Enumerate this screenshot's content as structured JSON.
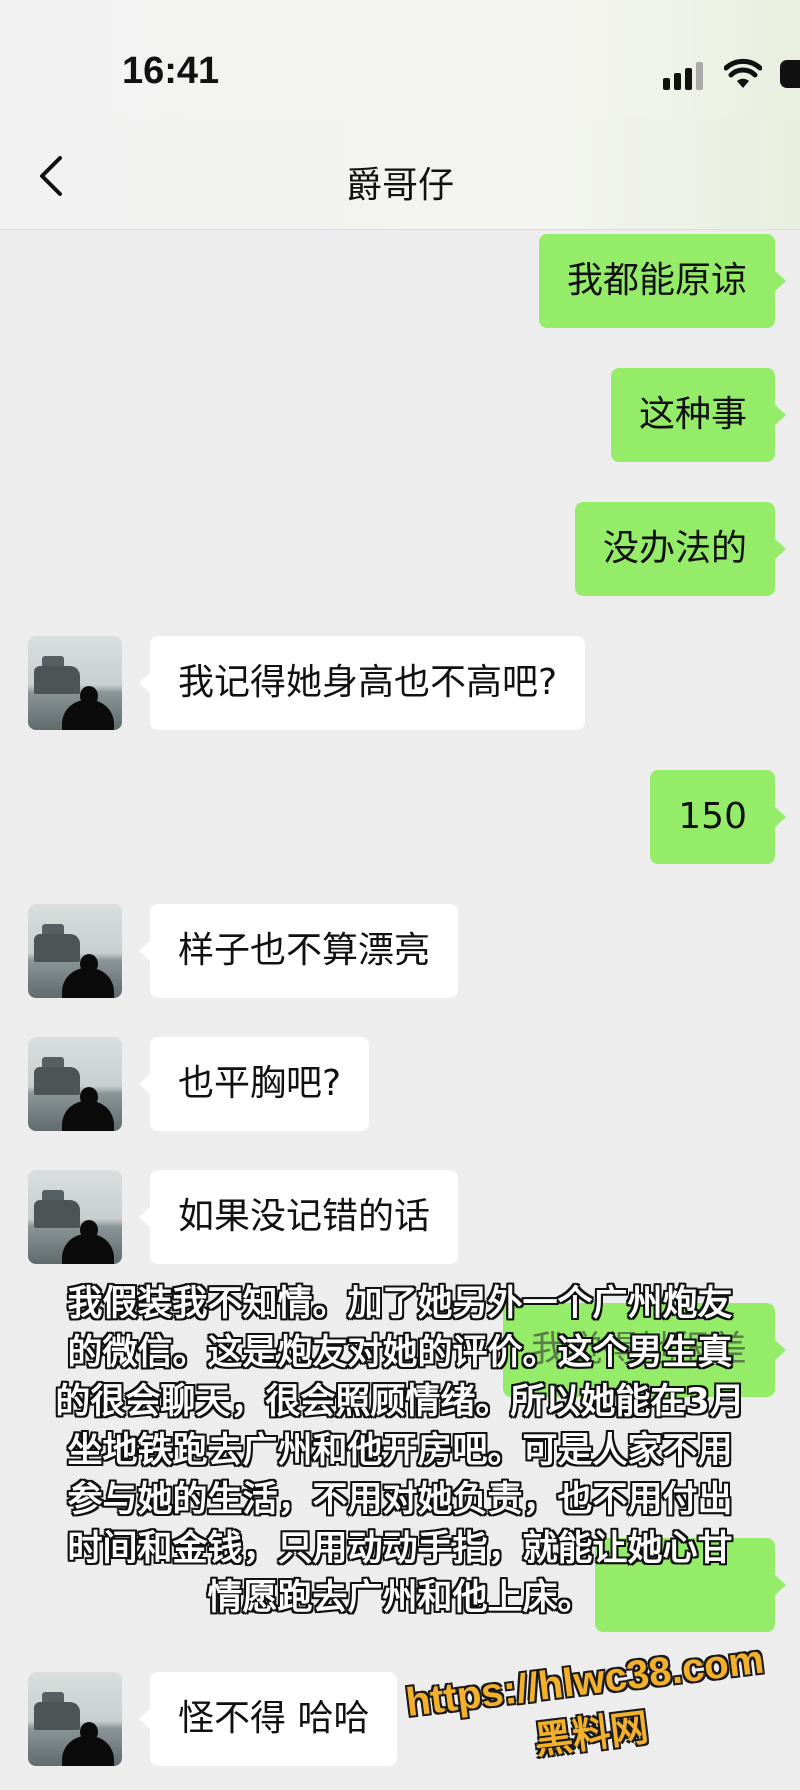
{
  "status_bar": {
    "time": "16:41"
  },
  "header": {
    "back_icon": "chevron-left-icon",
    "title": "爵哥仔"
  },
  "messages": [
    {
      "side": "out",
      "text": "我都能原谅"
    },
    {
      "side": "out",
      "text": "这种事"
    },
    {
      "side": "out",
      "text": "没办法的"
    },
    {
      "side": "in",
      "text": "我记得她身高也不高吧?"
    },
    {
      "side": "out",
      "text": "150"
    },
    {
      "side": "in",
      "text": "样子也不算漂亮"
    },
    {
      "side": "in",
      "text": "也平胸吧?"
    },
    {
      "side": "in",
      "text": "如果没记错的话"
    },
    {
      "side": "out",
      "text": "我觉得她很差"
    },
    {
      "side": "out",
      "text": ""
    },
    {
      "side": "in",
      "text": "怪不得 哈哈"
    }
  ],
  "overlay_caption": [
    "我假装我不知情。加了她另外一个广州炮友",
    "的微信。这是炮友对她的评价。这个男生真",
    "的很会聊天，很会照顾情绪。所以她能在3月",
    "坐地铁跑去广州和他开房吧。可是人家不用",
    "参与她的生活，不用对她负责，也不用付出",
    "时间和金钱，只用动动手指，就能让她心甘",
    "情愿跑去广州和他上床。"
  ],
  "watermark": {
    "url": "https://hlwc38.com",
    "name": "黑料网"
  },
  "colors": {
    "outgoing_bubble": "#95ec69",
    "incoming_bubble": "#ffffff",
    "background": "#ededed",
    "watermark": "#f3b02b"
  }
}
